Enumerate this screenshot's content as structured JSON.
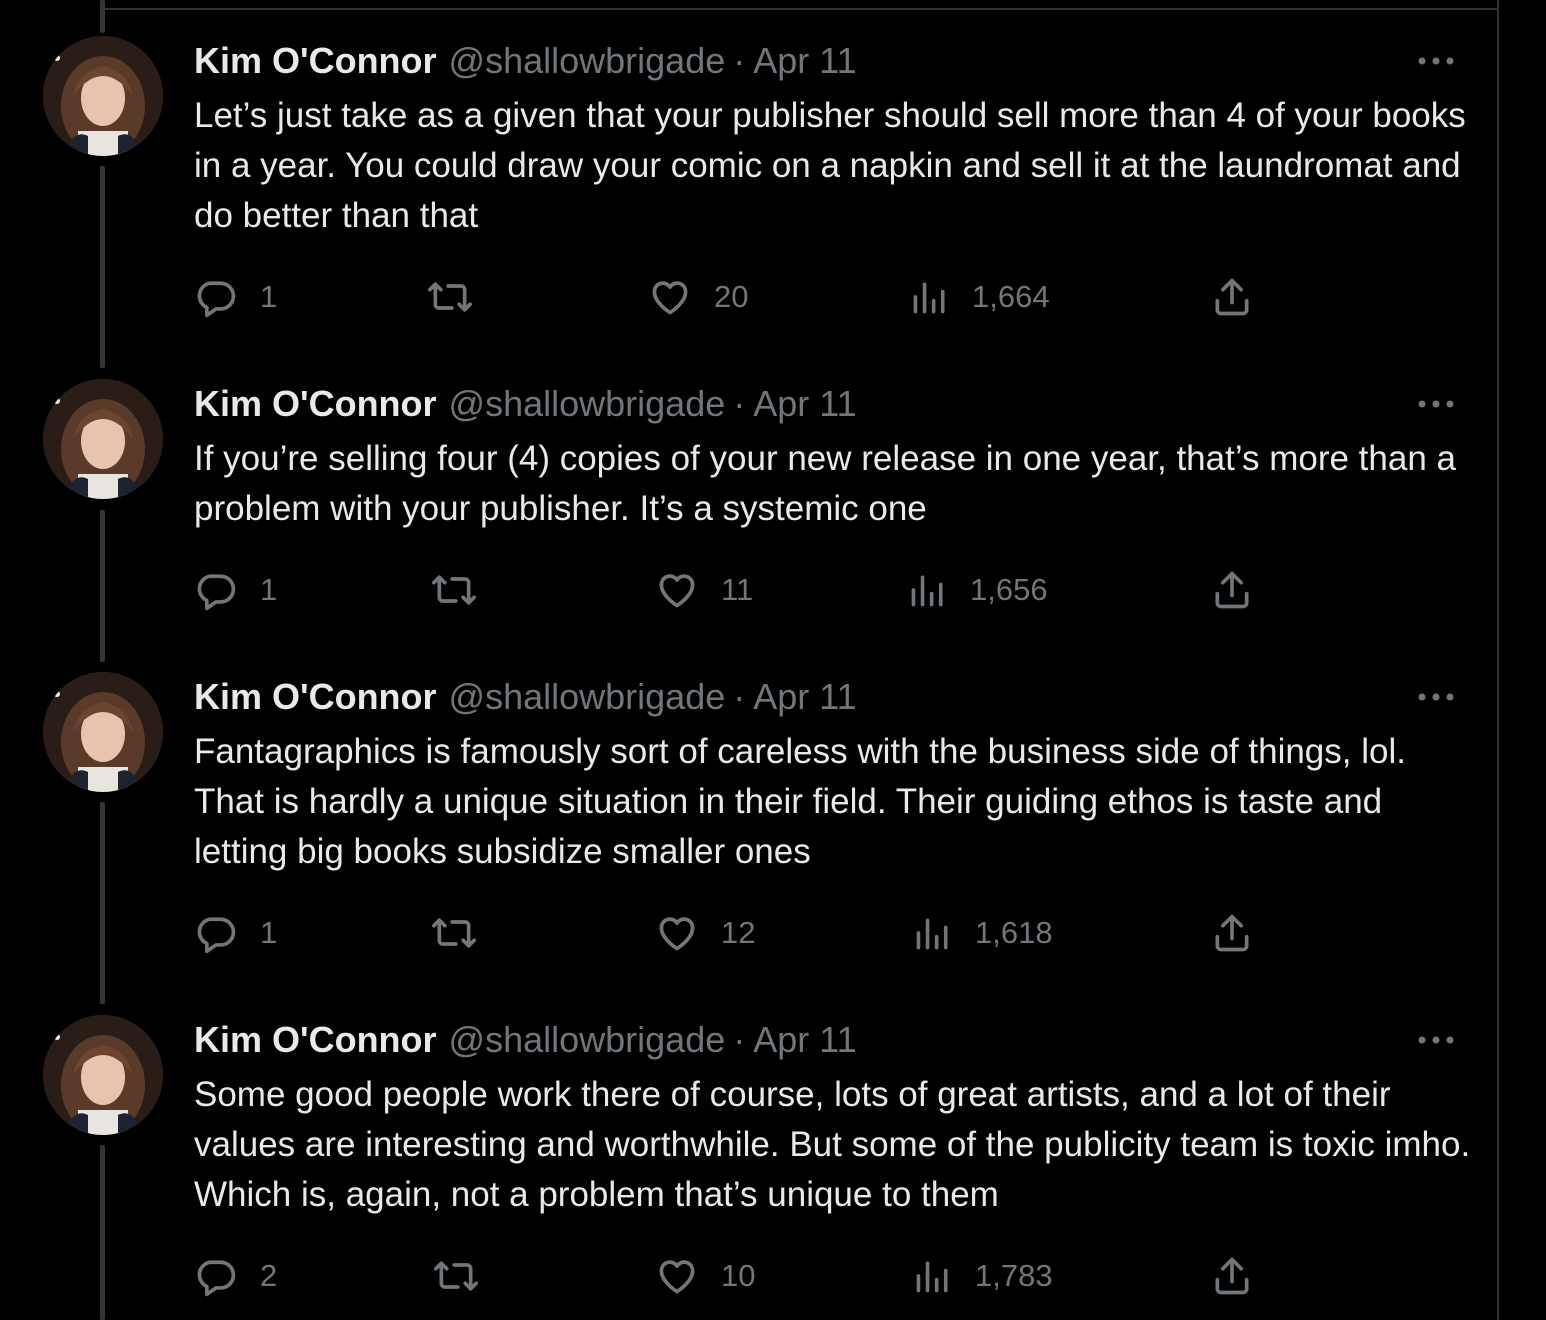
{
  "tweets": [
    {
      "name": "Kim O'Connor",
      "handle": "@shallowbrigade",
      "separator": "·",
      "date": "Apr 11",
      "text": "Let’s just take as a given that your publisher should sell more than 4 of your books in a year. You could draw your comic on a napkin and sell it at the laundromat and do better than that",
      "replies": "1",
      "retweets": "",
      "likes": "20",
      "views": "1,664"
    },
    {
      "name": "Kim O'Connor",
      "handle": "@shallowbrigade",
      "separator": "·",
      "date": "Apr 11",
      "text": "If you’re selling four (4) copies of your new release in one year, that’s more than a problem with your publisher. It’s a systemic one",
      "replies": "1",
      "retweets": "",
      "likes": "11",
      "views": "1,656"
    },
    {
      "name": "Kim O'Connor",
      "handle": "@shallowbrigade",
      "separator": "·",
      "date": "Apr 11",
      "text": "Fantagraphics is famously sort of careless with the business side of things, lol. That is hardly a unique situation in their field. Their guiding ethos is taste and letting big books subsidize smaller ones",
      "replies": "1",
      "retweets": "",
      "likes": "12",
      "views": "1,618"
    },
    {
      "name": "Kim O'Connor",
      "handle": "@shallowbrigade",
      "separator": "·",
      "date": "Apr 11",
      "text": "Some good people work there of course, lots of great artists, and a lot of their values are interesting and worthwhile. But some of the publicity team is toxic imho. Which is, again, not a problem that’s unique to them",
      "replies": "2",
      "retweets": "",
      "likes": "10",
      "views": "1,783"
    }
  ],
  "icons": {
    "reply": "reply-icon",
    "retweet": "retweet-icon",
    "like": "heart-icon",
    "views": "views-icon",
    "share": "share-icon",
    "more": "more-icon"
  },
  "colors": {
    "background": "#000000",
    "text": "#e7e9ea",
    "secondary": "#71767b",
    "border": "#2f3336"
  }
}
